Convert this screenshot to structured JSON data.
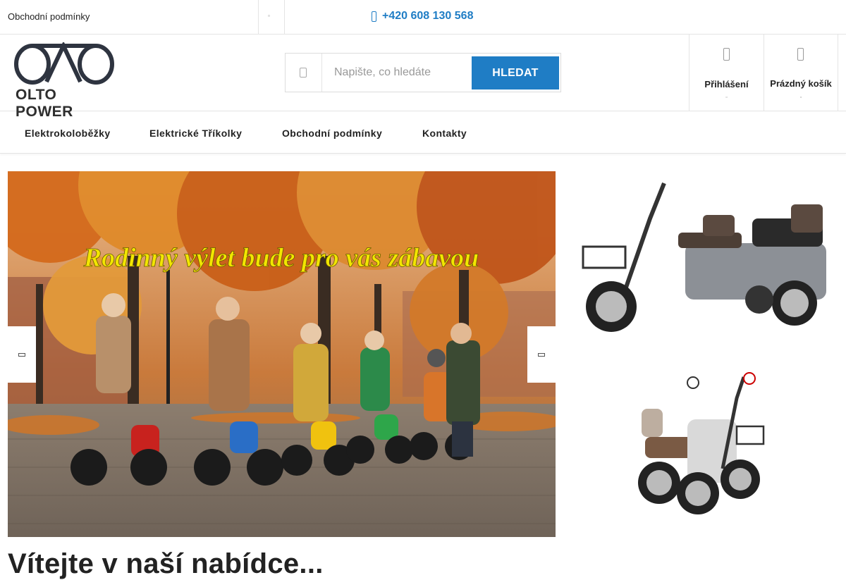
{
  "topbar": {
    "link_label": "Obchodní podmínky",
    "dots_icon": "ellipsis-icon",
    "phone": "+420 608 130 568",
    "phone_icon": "phone-icon"
  },
  "header": {
    "logo_text": "OLTO POWER",
    "search": {
      "placeholder": "Napište, co hledáte",
      "button_label": "HLEDAT",
      "icon": "search-icon"
    },
    "login": {
      "label": "Přihlášení",
      "icon": "user-icon"
    },
    "cart": {
      "label": "Prázdný košík",
      "icon": "cart-icon"
    }
  },
  "nav": {
    "items": [
      {
        "label": "Elektrokoloběžky"
      },
      {
        "label": "Elektrické Tříkolky"
      },
      {
        "label": "Obchodní podmínky"
      },
      {
        "label": "Kontakty"
      }
    ]
  },
  "hero": {
    "banner_text": "Rodinný výlet bude pro vás zábavou",
    "prev_icon": "chevron-left-icon",
    "next_icon": "chevron-right-icon"
  },
  "welcome": {
    "title": "Vítejte v naší nabídce..."
  },
  "colors": {
    "accent": "#1f7dc5",
    "banner_text": "#f2e600",
    "autumn_orange": "#d9761f"
  }
}
